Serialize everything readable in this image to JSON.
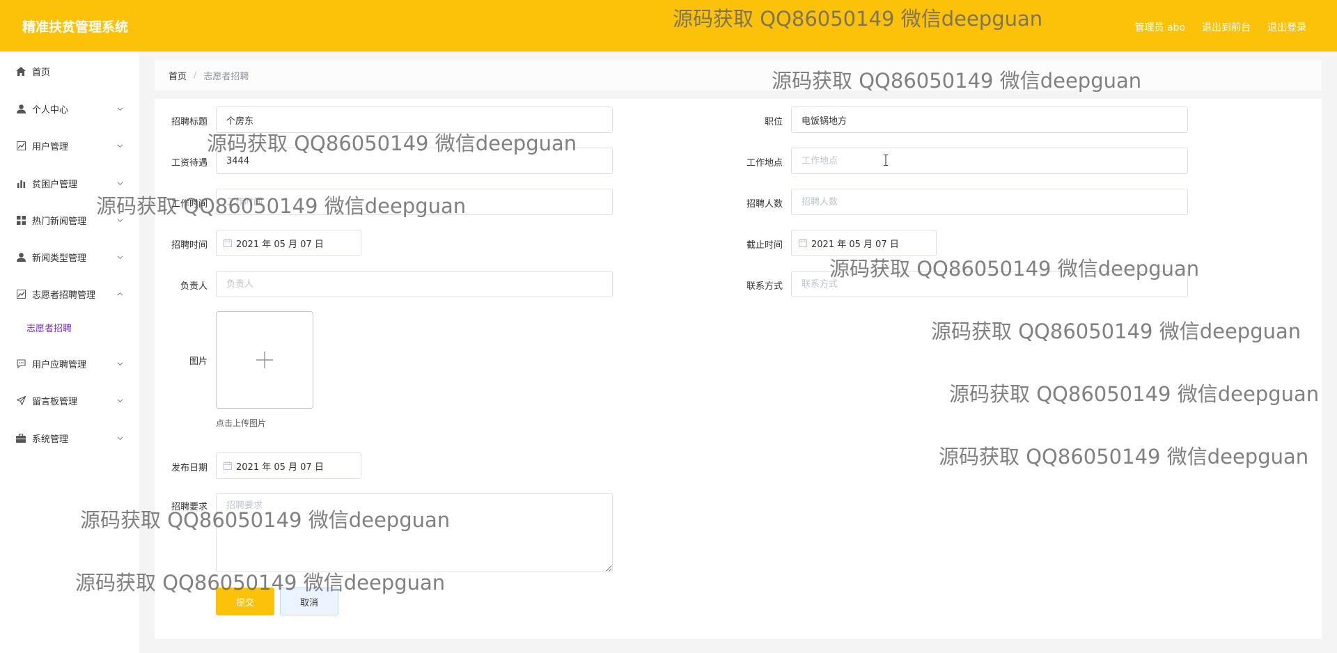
{
  "header": {
    "app_title": "精准扶贫管理系统",
    "user_label": "管理员 abo",
    "front_link": "退出到前台",
    "logout_link": "退出登录"
  },
  "sidebar": {
    "items": [
      {
        "label": "首页",
        "icon": "home-icon"
      },
      {
        "label": "个人中心",
        "icon": "person-icon"
      },
      {
        "label": "用户管理",
        "icon": "chart-box-icon"
      },
      {
        "label": "贫困户管理",
        "icon": "bar-chart-icon"
      },
      {
        "label": "热门新闻管理",
        "icon": "grid-icon"
      },
      {
        "label": "新闻类型管理",
        "icon": "person-icon"
      },
      {
        "label": "志愿者招聘管理",
        "icon": "chart-box-icon"
      },
      {
        "label": "用户应聘管理",
        "icon": "chat-icon"
      },
      {
        "label": "留言板管理",
        "icon": "send-icon"
      },
      {
        "label": "系统管理",
        "icon": "briefcase-icon"
      }
    ],
    "subitem": "志愿者招聘"
  },
  "breadcrumb": {
    "home": "首页",
    "separator": "/",
    "current": "志愿者招聘"
  },
  "form": {
    "title_label": "招聘标题",
    "title_value": "个房东",
    "position_label": "职位",
    "position_value": "电饭锅地方",
    "salary_label": "工资待遇",
    "salary_value": "3444",
    "location_label": "工作地点",
    "location_placeholder": "工作地点",
    "worktime_label": "工作时间",
    "worktime_placeholder": "工作时间",
    "headcount_label": "招聘人数",
    "headcount_placeholder": "招聘人数",
    "recruit_time_label": "招聘时间",
    "recruit_time_value": "2021 年 05 月 07 日",
    "deadline_label": "截止时间",
    "deadline_value": "2021 年 05 月 07 日",
    "manager_label": "负责人",
    "manager_placeholder": "负责人",
    "contact_label": "联系方式",
    "contact_placeholder": "联系方式",
    "image_label": "图片",
    "upload_hint": "点击上传图片",
    "publish_date_label": "发布日期",
    "publish_date_value": "2021 年 05 月 07 日",
    "requirements_label": "招聘要求",
    "requirements_placeholder": "招聘要求",
    "submit_label": "提交",
    "cancel_label": "取消"
  },
  "watermark_text": "源码获取 QQ86050149 微信deepguan"
}
